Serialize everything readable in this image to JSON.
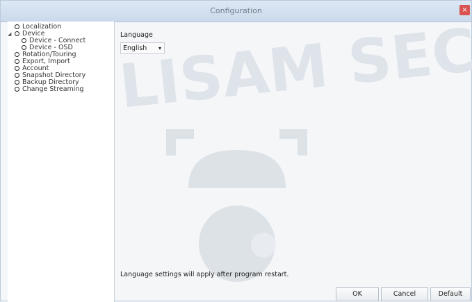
{
  "window": {
    "title": "Configuration",
    "close_label": "×"
  },
  "tree": [
    {
      "label": "Localization",
      "indent": 0,
      "toggle": ""
    },
    {
      "label": "Device",
      "indent": 0,
      "toggle": "◢"
    },
    {
      "label": "Device - Connect",
      "indent": 1,
      "toggle": ""
    },
    {
      "label": "Device - OSD",
      "indent": 1,
      "toggle": ""
    },
    {
      "label": "Rotation/Touring",
      "indent": 0,
      "toggle": ""
    },
    {
      "label": "Export, Import",
      "indent": 0,
      "toggle": ""
    },
    {
      "label": "Account",
      "indent": 0,
      "toggle": ""
    },
    {
      "label": "Snapshot Directory",
      "indent": 0,
      "toggle": ""
    },
    {
      "label": "Backup Directory",
      "indent": 0,
      "toggle": ""
    },
    {
      "label": "Change Streaming",
      "indent": 0,
      "toggle": ""
    }
  ],
  "language": {
    "label": "Language",
    "value": "English",
    "caret": "▾"
  },
  "note": "Language settings will apply after program restart.",
  "buttons": {
    "ok": "OK",
    "cancel": "Cancel",
    "default": "Default"
  },
  "watermark": {
    "text": "LISAM SECU"
  }
}
